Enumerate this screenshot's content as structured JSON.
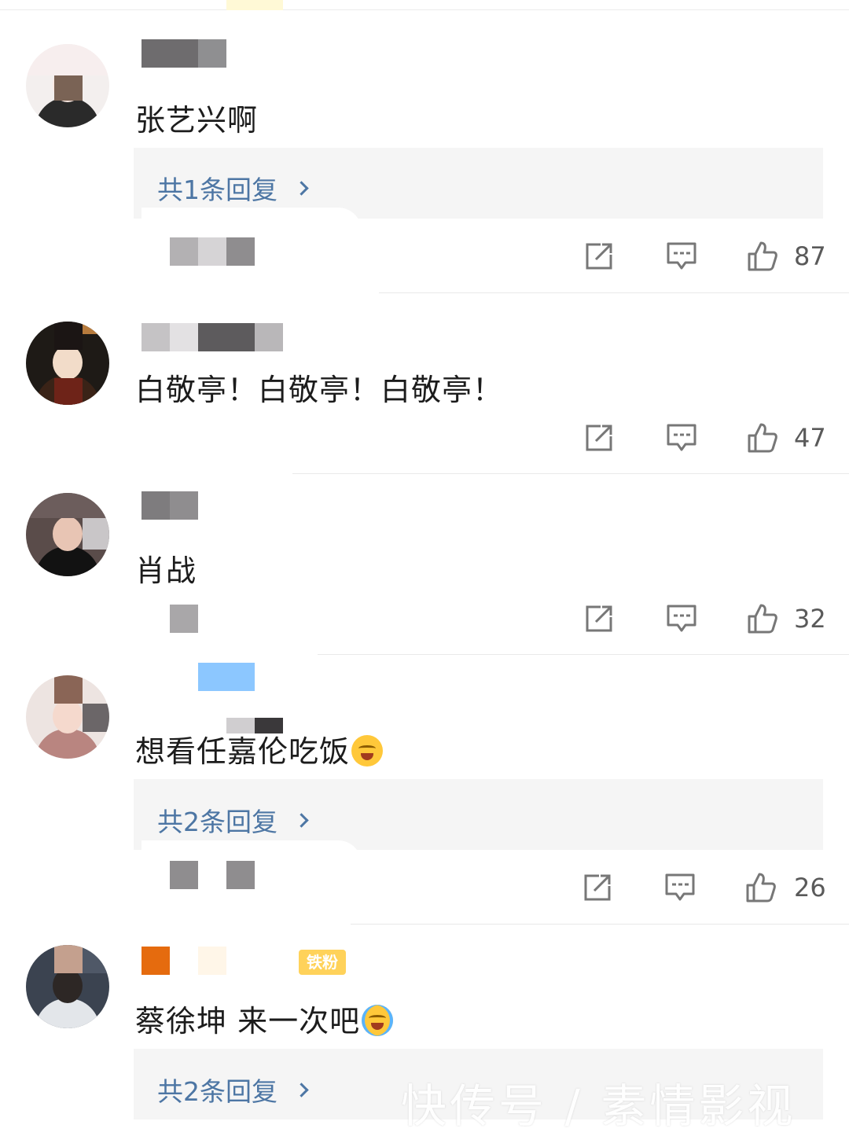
{
  "comments": [
    {
      "text": "张艺兴啊",
      "reply_label": "共1条回复",
      "likes": "87"
    },
    {
      "text": "白敬亭！白敬亭！白敬亭！",
      "likes": "47"
    },
    {
      "text": "肖战",
      "likes": "32"
    },
    {
      "text": "想看任嘉伦吃饭",
      "reply_label": "共2条回复",
      "likes": "26"
    },
    {
      "text": "蔡徐坤 来一次吧",
      "reply_label": "共2条回复",
      "badge": "铁粉"
    }
  ],
  "watermark": "快传号 / 素情影视",
  "icons": {
    "share": "share-icon",
    "comment": "comment-icon",
    "like": "thumbs-up-icon",
    "reply_chevron": "chevron-right-icon"
  },
  "colors": {
    "link": "#4d76a4",
    "reply_box": "#f5f5f5",
    "count": "#5a5a5a",
    "badge": "#ffd25a"
  }
}
